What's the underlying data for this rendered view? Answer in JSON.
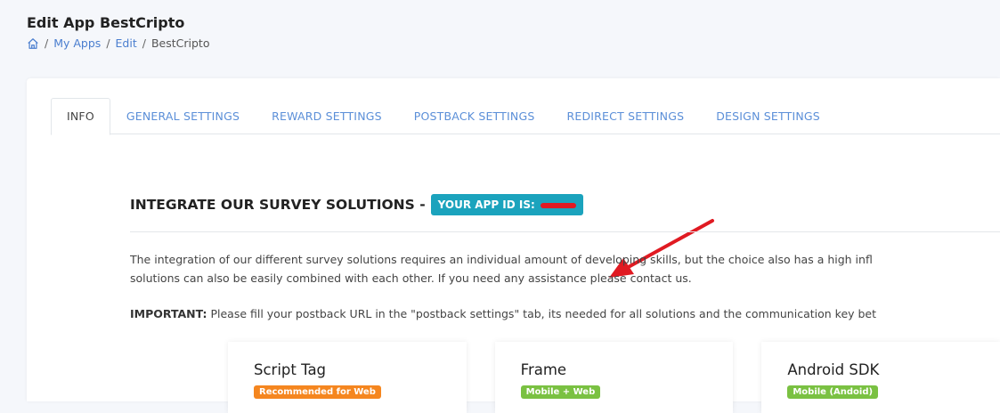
{
  "header": {
    "title": "Edit App BestCripto",
    "breadcrumb": [
      {
        "label": "My Apps",
        "link": true
      },
      {
        "label": "Edit",
        "link": true
      },
      {
        "label": "BestCripto",
        "link": false
      }
    ],
    "separator": "/"
  },
  "tabs": [
    {
      "label": "INFO",
      "active": true
    },
    {
      "label": "GENERAL SETTINGS",
      "active": false
    },
    {
      "label": "REWARD SETTINGS",
      "active": false
    },
    {
      "label": "POSTBACK SETTINGS",
      "active": false
    },
    {
      "label": "REDIRECT SETTINGS",
      "active": false
    },
    {
      "label": "DESIGN SETTINGS",
      "active": false
    }
  ],
  "section": {
    "title": "INTEGRATE OUR SURVEY SOLUTIONS -",
    "app_id_label": "YOUR APP ID IS:"
  },
  "content": {
    "line1": "The integration of our different survey solutions requires an individual amount of developing skills, but the choice also has a high infl",
    "line2": "solutions can also be easily combined with each other. If you need any assistance please contact us.",
    "important_label": "IMPORTANT:",
    "important_text": " Please fill your postback URL in the \"postback settings\" tab, its needed for all solutions and the communication key bet"
  },
  "solutions": [
    {
      "title": "Script Tag",
      "badge": "Recommended for Web",
      "badge_color": "#f5861f"
    },
    {
      "title": "Frame",
      "badge": "Mobile + Web",
      "badge_color": "#7ac142"
    },
    {
      "title": "Android SDK",
      "badge": "Mobile (Andoid)",
      "badge_color": "#7ac142"
    }
  ],
  "colors": {
    "accent_link": "#4a7ecf",
    "app_id_badge": "#1ba3bd",
    "annotation_arrow": "#e01a22"
  },
  "icons": {
    "breadcrumb_home": "home-icon",
    "annotation": "arrow-icon"
  }
}
